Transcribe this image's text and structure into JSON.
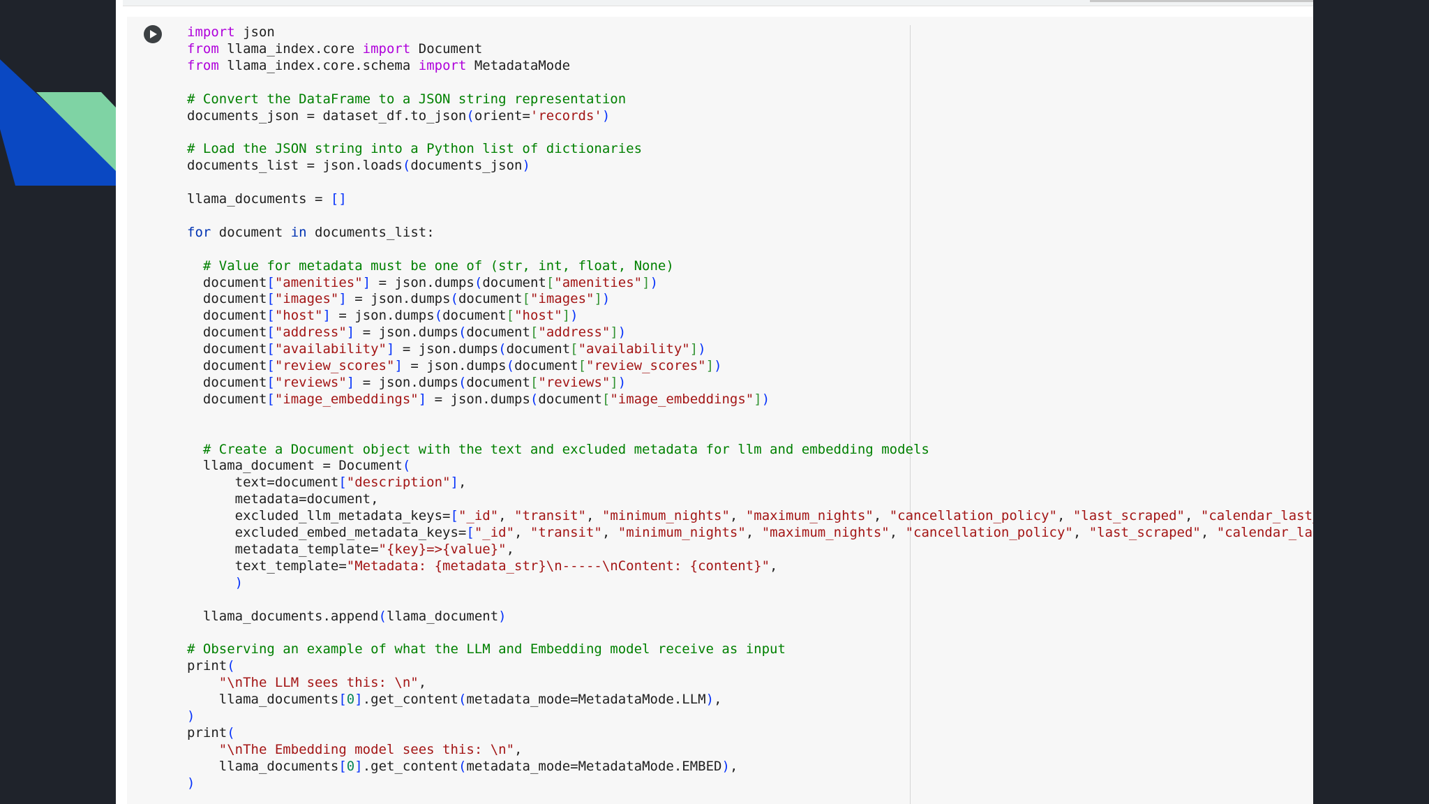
{
  "colors": {
    "background": "#1f232b",
    "accent_blue": "#0a48c2",
    "accent_green": "#7fd3a4",
    "panel": "#ffffff",
    "cell": "#f7f7f7"
  },
  "run_button": {
    "icon": "play-circle-icon"
  },
  "code_lines": [
    "import json",
    "from llama_index.core import Document",
    "from llama_index.core.schema import MetadataMode",
    "",
    "# Convert the DataFrame to a JSON string representation",
    "documents_json = dataset_df.to_json(orient='records')",
    "",
    "# Load the JSON string into a Python list of dictionaries",
    "documents_list = json.loads(documents_json)",
    "",
    "llama_documents = []",
    "",
    "for document in documents_list:",
    "",
    "  # Value for metadata must be one of (str, int, float, None)",
    "  document[\"amenities\"] = json.dumps(document[\"amenities\"])",
    "  document[\"images\"] = json.dumps(document[\"images\"])",
    "  document[\"host\"] = json.dumps(document[\"host\"])",
    "  document[\"address\"] = json.dumps(document[\"address\"])",
    "  document[\"availability\"] = json.dumps(document[\"availability\"])",
    "  document[\"review_scores\"] = json.dumps(document[\"review_scores\"])",
    "  document[\"reviews\"] = json.dumps(document[\"reviews\"])",
    "  document[\"image_embeddings\"] = json.dumps(document[\"image_embeddings\"])",
    "",
    "",
    "  # Create a Document object with the text and excluded metadata for llm and embedding models",
    "  llama_document = Document(",
    "      text=document[\"description\"],",
    "      metadata=document,",
    "      excluded_llm_metadata_keys=[\"_id\", \"transit\", \"minimum_nights\", \"maximum_nights\", \"cancellation_policy\", \"last_scraped\", \"calendar_last_scraped\", \"fi",
    "      excluded_embed_metadata_keys=[\"_id\", \"transit\", \"minimum_nights\", \"maximum_nights\", \"cancellation_policy\", \"last_scraped\", \"calendar_last_scraped\", \"",
    "      metadata_template=\"{key}=>{value}\",",
    "      text_template=\"Metadata: {metadata_str}\\n-----\\nContent: {content}\",",
    "      )",
    "",
    "  llama_documents.append(llama_document)",
    "",
    "# Observing an example of what the LLM and Embedding model receive as input",
    "print(",
    "    \"\\nThe LLM sees this: \\n\",",
    "    llama_documents[0].get_content(metadata_mode=MetadataMode.LLM),",
    ")",
    "print(",
    "    \"\\nThe Embedding model sees this: \\n\",",
    "    llama_documents[0].get_content(metadata_mode=MetadataMode.EMBED),",
    ")"
  ]
}
